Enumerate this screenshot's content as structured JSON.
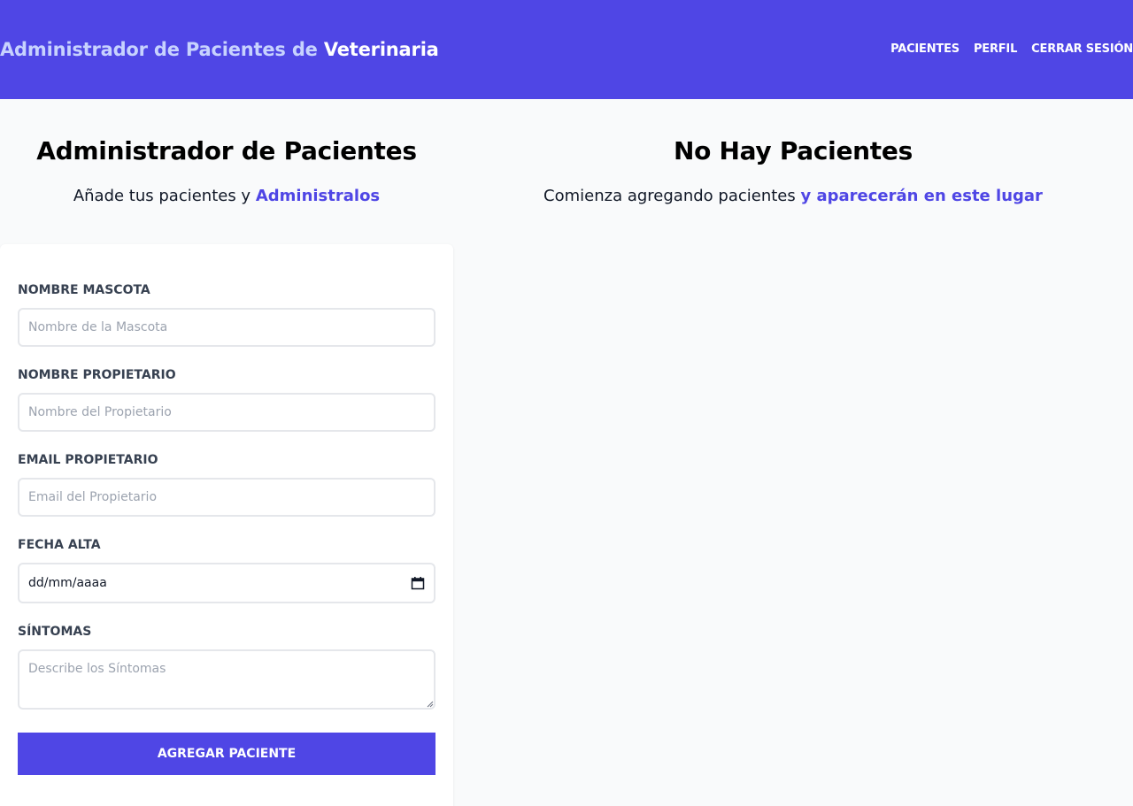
{
  "header": {
    "brand_prefix": "Administrador de Pacientes de",
    "brand_strong": "Veterinaria",
    "nav": [
      "PACIENTES",
      "PERFIL",
      "CERRAR SESIÓN"
    ]
  },
  "form_panel": {
    "title": "Administrador de Pacientes",
    "subtitle_text": "Añade tus pacientes y",
    "subtitle_accent": "Administralos"
  },
  "list_panel": {
    "title": "No Hay Pacientes",
    "subtitle_text": "Comienza agregando pacientes",
    "subtitle_accent": "y aparecerán en este lugar"
  },
  "form": {
    "fields": [
      {
        "label": "NOMBRE MASCOTA",
        "placeholder": "Nombre de la Mascota"
      },
      {
        "label": "NOMBRE PROPIETARIO",
        "placeholder": "Nombre del Propietario"
      },
      {
        "label": "EMAIL PROPIETARIO",
        "placeholder": "Email del Propietario"
      },
      {
        "label": "FECHA ALTA",
        "value": "dd/mm/aaaa"
      },
      {
        "label": "SÍNTOMAS",
        "placeholder": "Describe los Síntomas"
      }
    ],
    "submit_label": "AGREGAR PACIENTE"
  },
  "colors": {
    "primary": "#4f46e5",
    "brand_light": "#c7d2fe",
    "page_bg": "#f9fafb"
  }
}
